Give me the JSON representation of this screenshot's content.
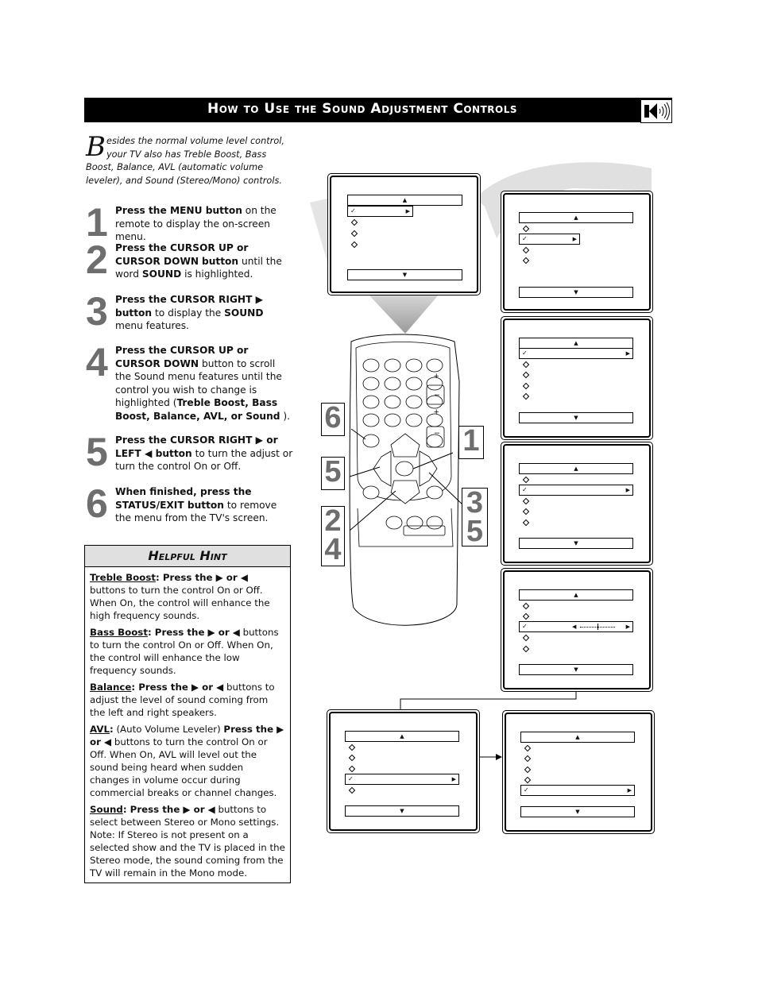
{
  "header": {
    "title": "How to Use the Sound Adjustment Controls",
    "icon": "speaker-icon"
  },
  "intro": {
    "drop_cap": "B",
    "text": "esides the normal volume level control, your TV also has Treble Boost, Bass Boost, Balance, AVL (automatic volume leveler), and Sound (Stereo/Mono) controls."
  },
  "steps": [
    {
      "number": "1",
      "bold": "Press the MENU button",
      "rest": " on the remote to display the on-screen menu."
    },
    {
      "number": "2",
      "bold1": "Press the CURSOR UP",
      "mid1": " or ",
      "bold2": "CURSOR DOWN",
      "mid2": " ",
      "bold3": "button",
      "rest": " until the word ",
      "bold4": "SOUND",
      "rest2": " is highlighted."
    },
    {
      "number": "3",
      "bold": "Press the CURSOR RIGHT ▶ button",
      "rest": " to display the ",
      "bold2": "SOUND",
      "rest2": " menu features."
    },
    {
      "number": "4",
      "bold": "Press the CURSOR UP or CURSOR DOWN",
      "rest": " button to scroll the Sound menu features until the control you wish to change is highlighted (",
      "bold2": "Treble Boost, Bass Boost, Balance, AVL, or Sound",
      "rest2": " )."
    },
    {
      "number": "5",
      "bold": "Press the CURSOR RIGHT ▶ or LEFT ◀ button",
      "rest": " to turn the adjust or turn the control On or Off."
    },
    {
      "number": "6",
      "bold": "When finished, press the STATUS/EXIT button",
      "rest": " to remove the menu from the TV's screen."
    }
  ],
  "hint": {
    "title": "Helpful Hint",
    "items": [
      {
        "term": "Treble Boost",
        "bold": "Press the ▶ or ◀",
        "text": " buttons to turn the control On or Off. When On, the control will enhance the high frequency sounds."
      },
      {
        "term": "Bass Boost",
        "bold": "Press the ▶ or ◀",
        "text": " buttons to turn the control On or Off. When On, the control will enhance the low frequency sounds."
      },
      {
        "term": "Balance",
        "bold": "Press the ▶ or ◀",
        "text": " buttons to adjust the level of sound coming from the left and right speakers."
      },
      {
        "term": "AVL",
        "pre": " (Auto Volume Leveler) ",
        "bold": "Press the ▶ or ◀",
        "text": " buttons to turn the control On or Off. When On, AVL will level out the sound being heard when sudden changes in volume occur during commercial breaks or channel changes."
      },
      {
        "term": "Sound",
        "bold": "Press the ▶ or ◀",
        "text": " buttons to select between Stereo or Mono settings. Note: If Stereo is not present on a selected show and the TV is placed in the Stereo mode, the sound coming from the TV will remain in the Mono mode."
      }
    ]
  },
  "callouts": {
    "c6": "6",
    "c5": "5",
    "c24_a": "2",
    "c24_b": "4",
    "c1": "1",
    "c35_a": "3",
    "c35_b": "5"
  },
  "glyphs": {
    "up": "▲",
    "down": "▼",
    "right": "▶",
    "left": "◀",
    "check": "✓"
  },
  "screens": [
    {
      "id": "main-menu",
      "items": 4,
      "selected": 0
    },
    {
      "id": "sound-entry",
      "items": 4,
      "selected": 1
    },
    {
      "id": "treble-boost",
      "items": 5,
      "selected": 0
    },
    {
      "id": "bass-boost",
      "items": 5,
      "selected": 1
    },
    {
      "id": "balance",
      "items": 5,
      "selected": 2,
      "slider_value": 0.5
    },
    {
      "id": "avl",
      "items": 5,
      "selected": 3
    },
    {
      "id": "sound",
      "items": 5,
      "selected": 4
    }
  ]
}
